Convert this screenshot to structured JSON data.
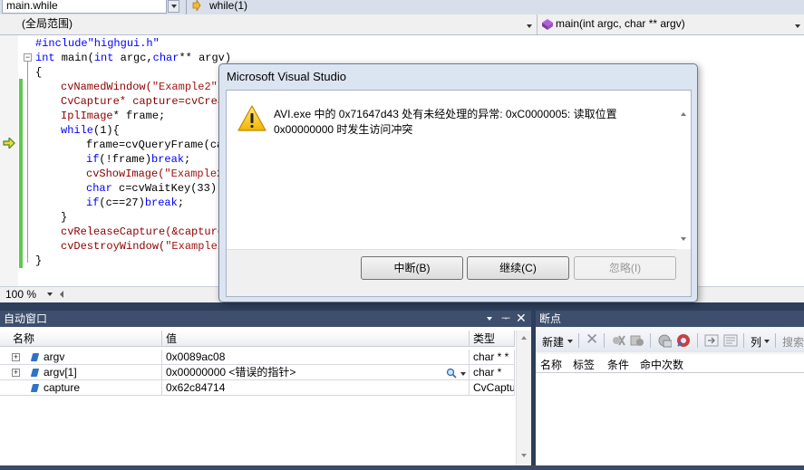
{
  "nav": {
    "file_combo": "main.while",
    "scope_combo": "while(1)",
    "scope_global": "(全局范围)",
    "function_combo": "main(int argc, char ** argv)"
  },
  "code_lines": {
    "l1": "#include\"highgui.h\"",
    "l2a": "int",
    "l2b": " main(",
    "l2c": "int",
    "l2d": " argc,",
    "l2e": "char",
    "l2f": "** argv)",
    "l3": "{",
    "l4a": "cvNamedWindow(",
    "l4b": "\"Example2\",",
    "l5a": "CvCapture",
    "l5b": "* capture=cvCrea",
    "l6a": "IplImage",
    "l6b": "* frame;",
    "l7a": "while",
    "l7b": "(1){",
    "l8": "frame=cvQueryFrame(ca",
    "l9a": "if",
    "l9b": "(!frame)",
    "l9c": "break",
    "l9d": ";",
    "l10a": "cvShowImage(",
    "l10b": "\"Example2",
    "l11a": "char",
    "l11b": " c=cvWaitKey(33);",
    "l12a": "if",
    "l12b": "(c==27)",
    "l12c": "break",
    "l12d": ";",
    "l13": "}",
    "l14": "cvReleaseCapture(&capture",
    "l15a": "cvDestroyWindow(",
    "l15b": "\"Example2",
    "l16": "}"
  },
  "zoom": "100 %",
  "dialog": {
    "title": "Microsoft Visual Studio",
    "message_line1": "AVI.exe 中的 0x71647d43 处有未经处理的异常: 0xC0000005: 读取位置",
    "message_line2": "0x00000000 时发生访问冲突",
    "btn_break": "中断(B)",
    "btn_continue": "继续(C)",
    "btn_ignore": "忽略(I)"
  },
  "autos": {
    "title": "自动窗口",
    "col_name": "名称",
    "col_value": "值",
    "col_type": "类型",
    "rows": [
      {
        "name": "argv",
        "value": "0x0089ac08",
        "type": "char * *"
      },
      {
        "name": "argv[1]",
        "value": "0x00000000 <错误的指针>",
        "type": "char *"
      },
      {
        "name": "capture",
        "value": "0x62c84714",
        "type": "CvCaptu"
      }
    ]
  },
  "breakpoints": {
    "title": "断点",
    "new_label": "新建",
    "columns_label": "列",
    "search_label": "搜索",
    "col_name": "名称",
    "col_label": "标签",
    "col_condition": "条件",
    "col_hitcount": "命中次数"
  }
}
